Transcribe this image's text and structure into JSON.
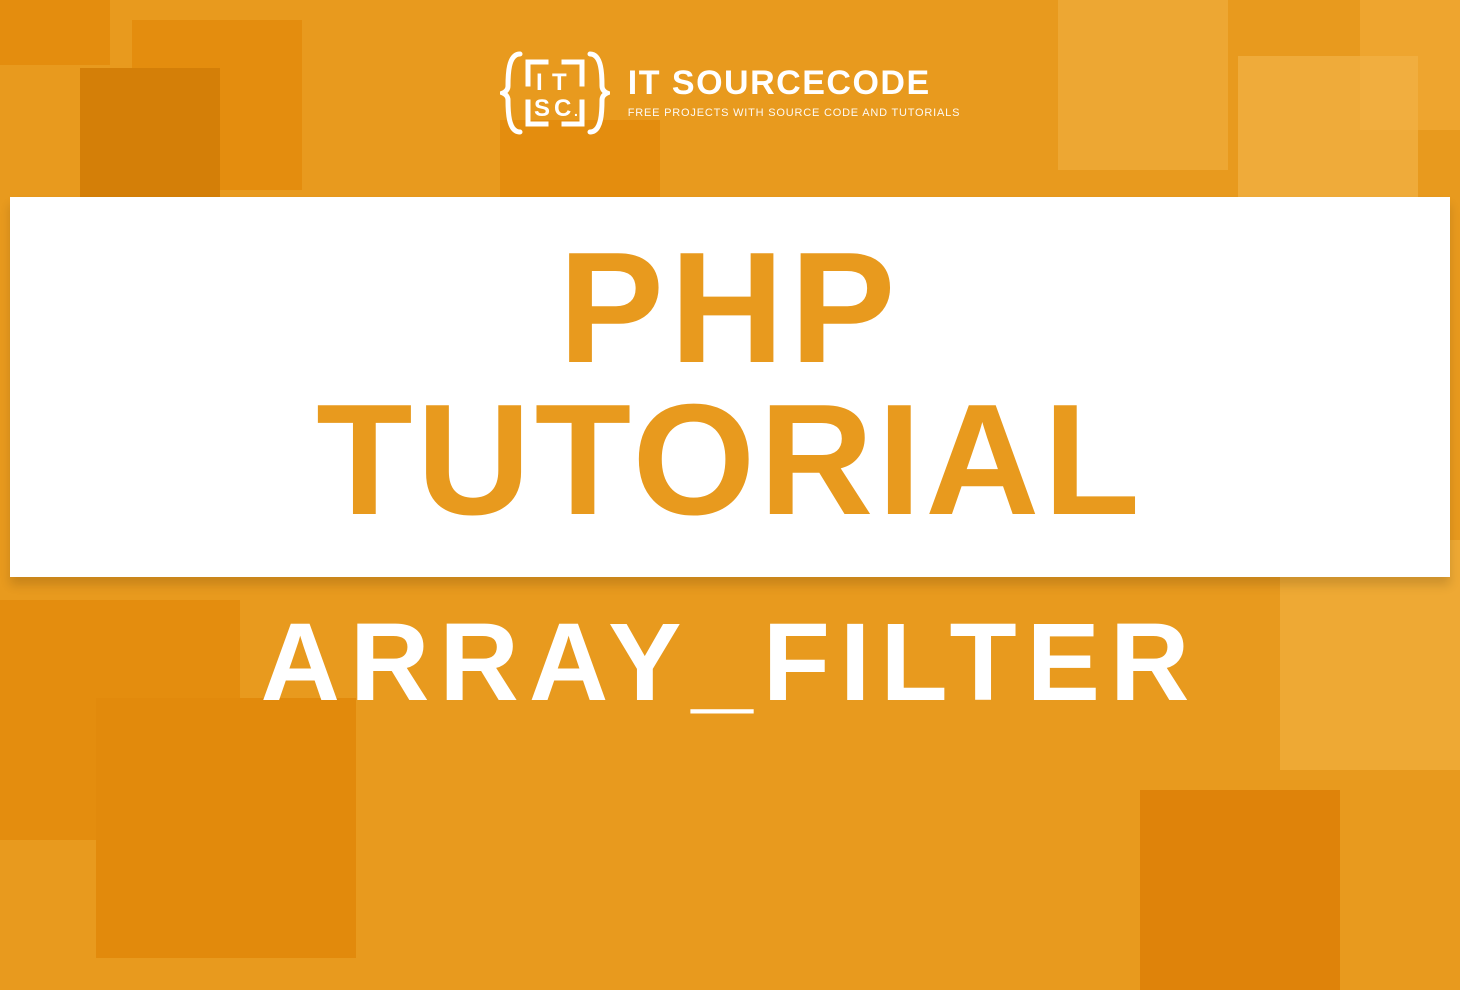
{
  "brand": {
    "name": "IT SOURCECODE",
    "tagline": "FREE PROJECTS WITH SOURCE CODE AND TUTORIALS"
  },
  "hero": {
    "line1": "PHP",
    "line2": "TUTORIAL",
    "subtitle": "ARRAY_FILTER"
  },
  "colors": {
    "accent": "#e89a1e",
    "white": "#ffffff"
  }
}
